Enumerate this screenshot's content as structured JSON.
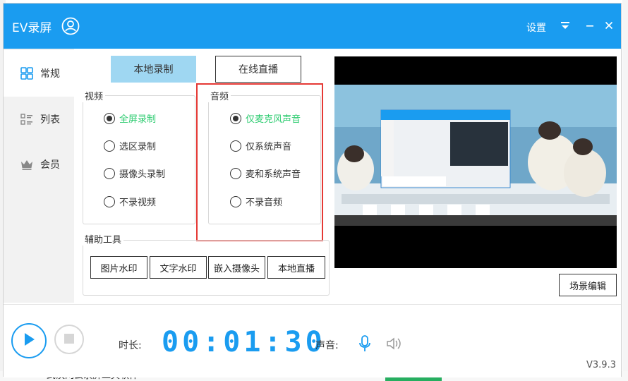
{
  "app": {
    "title": "EV录屏"
  },
  "titlebar": {
    "settings_label": "设置"
  },
  "sidebar": {
    "items": [
      {
        "label": "常规",
        "icon": "grid-icon"
      },
      {
        "label": "列表",
        "icon": "list-icon"
      },
      {
        "label": "会员",
        "icon": "crown-icon"
      }
    ]
  },
  "mode": {
    "local_label": "本地录制",
    "online_label": "在线直播"
  },
  "video": {
    "title": "视频",
    "options": [
      "全屏录制",
      "选区录制",
      "摄像头录制",
      "不录视频"
    ],
    "selected": 0
  },
  "audio": {
    "title": "音频",
    "options": [
      "仅麦克风声音",
      "仅系统声音",
      "麦和系统声音",
      "不录音频"
    ],
    "selected": 0
  },
  "tools": {
    "title": "辅助工具",
    "buttons": [
      "图片水印",
      "文字水印",
      "嵌入摄像头",
      "本地直播"
    ]
  },
  "scene_edit_label": "场景编辑",
  "bottom": {
    "duration_label": "时长:",
    "timer": "00:01:30",
    "sound_label": "声音:",
    "version": "V3.9.3"
  },
  "background": {
    "bottom_text": "武汉网云录屏工具软件"
  },
  "colors": {
    "accent": "#1a9cf0",
    "selected_text": "#2ecc71",
    "highlight_box": "#e53935"
  }
}
